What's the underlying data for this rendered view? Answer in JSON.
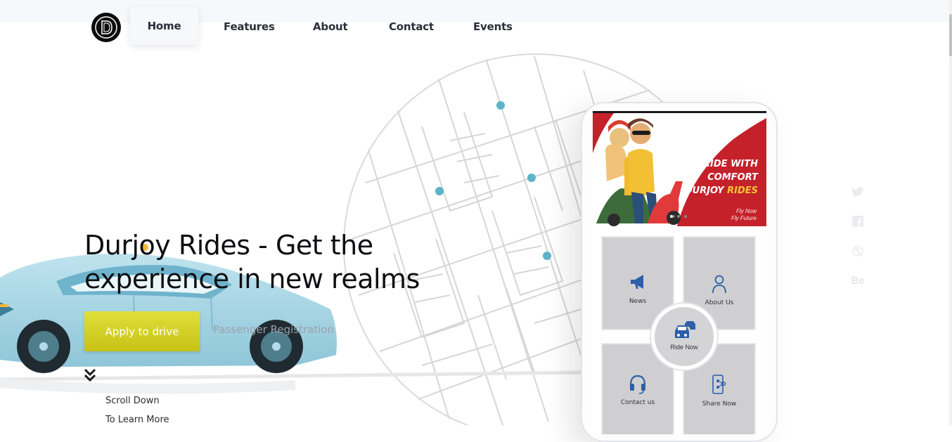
{
  "nav": {
    "logo_alt": "Durjoy Rides logo",
    "items": [
      {
        "label": "Home",
        "active": true
      },
      {
        "label": "Features",
        "active": false
      },
      {
        "label": "About",
        "active": false
      },
      {
        "label": "Contact",
        "active": false
      },
      {
        "label": "Events",
        "active": false
      }
    ]
  },
  "hero": {
    "title_line1": "Durjoy Rides - Get the",
    "title_line2": "experience in new realms",
    "apply_label": "Apply to drive",
    "passenger_label": "Passenger Registration",
    "scroll_line1": "Scroll Down",
    "scroll_line2": "To Learn More"
  },
  "social": {
    "icons": [
      "twitter-icon",
      "facebook-icon",
      "dribbble-icon",
      "behance-icon"
    ],
    "behance_label": "Be"
  },
  "phone": {
    "banner": {
      "line1": "RIDE WITH",
      "line2": "COMFORT",
      "line3a": "DURJOY",
      "line3b": "RIDES",
      "tag1": "Fly Now",
      "tag2": "Fly Future"
    },
    "tiles": {
      "news": "News",
      "about": "About Us",
      "ride": "Ride Now",
      "contact": "Contact us",
      "share": "Share Now"
    }
  },
  "colors": {
    "accent_yellow": "#d4cf22",
    "map_dot": "#5db3c9",
    "banner_red": "#c4212b",
    "icon_blue": "#2c5fa8",
    "car_body": "#a9d8e6"
  }
}
